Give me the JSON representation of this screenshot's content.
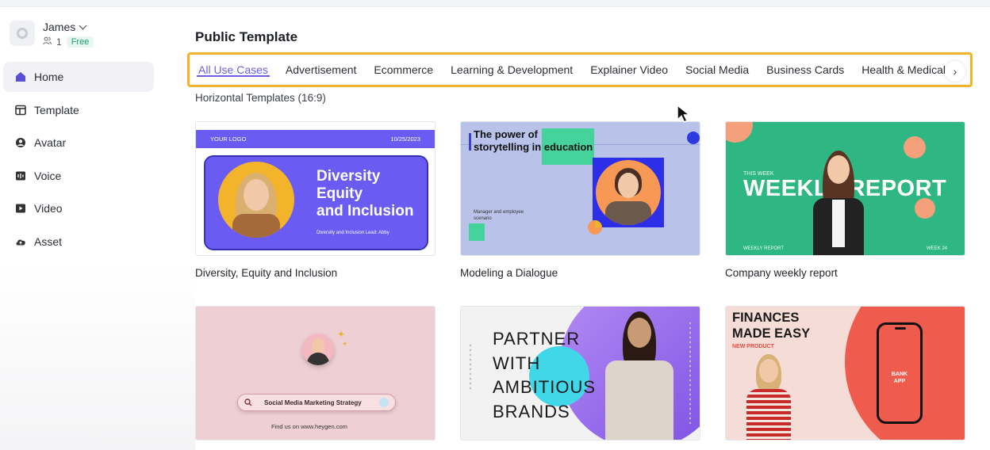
{
  "account": {
    "name": "James",
    "member_count": "1",
    "plan": "Free"
  },
  "sidebar": {
    "items": [
      {
        "label": "Home",
        "icon": "home-icon",
        "active": true
      },
      {
        "label": "Template",
        "icon": "template-icon"
      },
      {
        "label": "Avatar",
        "icon": "avatar-icon"
      },
      {
        "label": "Voice",
        "icon": "voice-icon"
      },
      {
        "label": "Video",
        "icon": "video-icon"
      },
      {
        "label": "Asset",
        "icon": "cloud-icon"
      }
    ]
  },
  "main": {
    "title": "Public Template",
    "tabs": [
      {
        "label": "All Use Cases",
        "active": true
      },
      {
        "label": "Advertisement"
      },
      {
        "label": "Ecommerce"
      },
      {
        "label": "Learning & Development"
      },
      {
        "label": "Explainer Video"
      },
      {
        "label": "Social Media"
      },
      {
        "label": "Business Cards"
      },
      {
        "label": "Health & Medical"
      }
    ],
    "section_label": "Horizontal Templates (16:9)",
    "templates": [
      {
        "title": "Diversity, Equity and Inclusion",
        "thumb": {
          "logo": "YOUR LOGO",
          "date": "10/25/2023",
          "headline": [
            "Diversity",
            "Equity",
            "and Inclusion"
          ],
          "sub": "Diversity and Inclusion Lead: Abby"
        }
      },
      {
        "title": "Modeling a Dialogue",
        "thumb": {
          "headline": [
            "The power of",
            "storytelling in education"
          ],
          "small": [
            "Manager and employee",
            "scenario"
          ]
        }
      },
      {
        "title": "Company weekly report",
        "thumb": {
          "kicker": "THIS WEEK",
          "headline": "WEEKLY REPORT",
          "footer_left": "WEEKLY REPORT",
          "footer_right": "WEEK 24"
        }
      },
      {
        "title": "",
        "thumb": {
          "search_text": "Social Media Marketing Strategy",
          "footer": "Find us on www.heygen.com"
        }
      },
      {
        "title": "",
        "thumb": {
          "headline": [
            "PARTNER",
            "WITH",
            "AMBITIOUS",
            "BRANDS"
          ]
        }
      },
      {
        "title": "",
        "thumb": {
          "headline": [
            "FINANCES",
            "MADE EASY"
          ],
          "sub": "NEW PRODUCT",
          "phone_text": [
            "BANK",
            "APP"
          ]
        }
      }
    ]
  },
  "colors": {
    "accent": "#6b5ee8",
    "highlight_border": "#f0b429",
    "free_badge": "#1f9b6f"
  }
}
